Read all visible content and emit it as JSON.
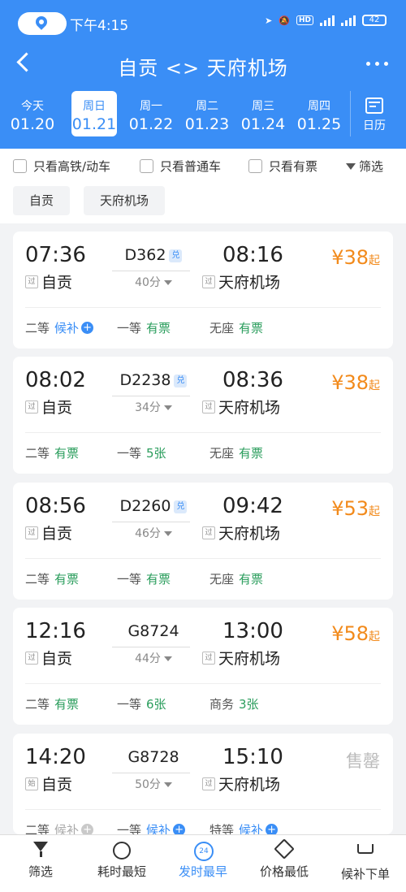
{
  "status_bar": {
    "time": "下午4:15",
    "battery": "42",
    "hd": "HD"
  },
  "header": {
    "title": "自贡 <> 天府机场"
  },
  "date_tabs": [
    {
      "weekday": "今天",
      "date": "01.20"
    },
    {
      "weekday": "周日",
      "date": "01.21",
      "selected": true
    },
    {
      "weekday": "周一",
      "date": "01.22"
    },
    {
      "weekday": "周二",
      "date": "01.23"
    },
    {
      "weekday": "周三",
      "date": "01.24"
    },
    {
      "weekday": "周四",
      "date": "01.25"
    }
  ],
  "calendar_label": "日历",
  "filters": {
    "high_speed": "只看高铁/动车",
    "regular": "只看普通车",
    "available": "只看有票",
    "filter": "筛选"
  },
  "stations": {
    "from": "自贡",
    "to": "天府机场"
  },
  "trains": [
    {
      "dep": "07:36",
      "arr": "08:16",
      "no": "D362",
      "dui": "兑",
      "dur": "40分",
      "from_badge": "过",
      "from": "自贡",
      "to_badge": "过",
      "to": "天府机场",
      "price": "¥38",
      "price_suffix": "起",
      "seats": [
        {
          "type": "二等",
          "val": "候补",
          "plus": true
        },
        {
          "type": "一等",
          "val": "有票"
        },
        {
          "type": "无座",
          "val": "有票"
        }
      ]
    },
    {
      "dep": "08:02",
      "arr": "08:36",
      "no": "D2238",
      "dui": "兑",
      "dur": "34分",
      "from_badge": "过",
      "from": "自贡",
      "to_badge": "过",
      "to": "天府机场",
      "price": "¥38",
      "price_suffix": "起",
      "seats": [
        {
          "type": "二等",
          "val": "有票"
        },
        {
          "type": "一等",
          "val": "5张"
        },
        {
          "type": "无座",
          "val": "有票"
        }
      ]
    },
    {
      "dep": "08:56",
      "arr": "09:42",
      "no": "D2260",
      "dui": "兑",
      "dur": "46分",
      "from_badge": "过",
      "from": "自贡",
      "to_badge": "过",
      "to": "天府机场",
      "price": "¥53",
      "price_suffix": "起",
      "seats": [
        {
          "type": "二等",
          "val": "有票"
        },
        {
          "type": "一等",
          "val": "有票"
        },
        {
          "type": "无座",
          "val": "有票"
        }
      ]
    },
    {
      "dep": "12:16",
      "arr": "13:00",
      "no": "G8724",
      "dur": "44分",
      "from_badge": "过",
      "from": "自贡",
      "to_badge": "过",
      "to": "天府机场",
      "price": "¥58",
      "price_suffix": "起",
      "seats": [
        {
          "type": "二等",
          "val": "有票"
        },
        {
          "type": "一等",
          "val": "6张"
        },
        {
          "type": "商务",
          "val": "3张"
        }
      ]
    },
    {
      "dep": "14:20",
      "arr": "15:10",
      "no": "G8728",
      "dur": "50分",
      "from_badge": "始",
      "from": "自贡",
      "to_badge": "过",
      "to": "天府机场",
      "sold_out": "售罄",
      "seats": [
        {
          "type": "二等",
          "val": "候补",
          "plus": true,
          "grey": true
        },
        {
          "type": "一等",
          "val": "候补",
          "plus": true
        },
        {
          "type": "特等",
          "val": "候补",
          "plus": true
        }
      ]
    }
  ],
  "bottom_tabs": [
    {
      "label": "筛选",
      "icon": "funnel-icon"
    },
    {
      "label": "耗时最短",
      "icon": "clock-icon"
    },
    {
      "label": "发时最早",
      "icon": "24-icon",
      "badge": "24",
      "active": true
    },
    {
      "label": "价格最低",
      "icon": "price-tag-icon"
    },
    {
      "label": "候补下单",
      "icon": "cart-icon"
    }
  ],
  "colors": {
    "primary": "#3a8ef6",
    "price": "#f28a1b",
    "available": "#2a9d5c"
  }
}
